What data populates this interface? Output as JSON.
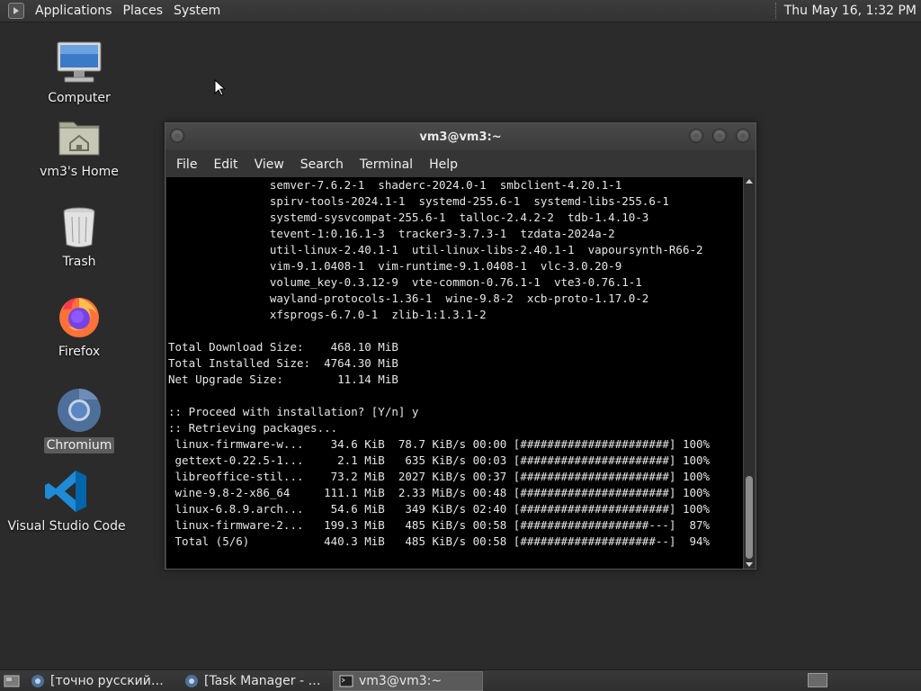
{
  "top_panel": {
    "menu": [
      "Applications",
      "Places",
      "System"
    ],
    "clock": "Thu May 16,  1:32 PM"
  },
  "desktop_icons": [
    {
      "label": "Computer",
      "icon": "computer-icon"
    },
    {
      "label": "vm3's Home",
      "icon": "home-folder-icon"
    },
    {
      "label": "Trash",
      "icon": "trash-icon"
    },
    {
      "label": "Firefox",
      "icon": "firefox-icon"
    },
    {
      "label": "Chromium",
      "icon": "chromium-icon",
      "selected": true
    },
    {
      "label": "Visual Studio Code",
      "icon": "vscode-icon"
    }
  ],
  "terminal": {
    "title": "vm3@vm3:~",
    "menu": [
      "File",
      "Edit",
      "View",
      "Search",
      "Terminal",
      "Help"
    ],
    "lines": [
      "               semver-7.6.2-1  shaderc-2024.0-1  smbclient-4.20.1-1",
      "               spirv-tools-2024.1-1  systemd-255.6-1  systemd-libs-255.6-1",
      "               systemd-sysvcompat-255.6-1  talloc-2.4.2-2  tdb-1.4.10-3",
      "               tevent-1:0.16.1-3  tracker3-3.7.3-1  tzdata-2024a-2",
      "               util-linux-2.40.1-1  util-linux-libs-2.40.1-1  vapoursynth-R66-2",
      "               vim-9.1.0408-1  vim-runtime-9.1.0408-1  vlc-3.0.20-9",
      "               volume_key-0.3.12-9  vte-common-0.76.1-1  vte3-0.76.1-1",
      "               wayland-protocols-1.36-1  wine-9.8-2  xcb-proto-1.17.0-2",
      "               xfsprogs-6.7.0-1  zlib-1:1.3.1-2",
      "",
      "Total Download Size:    468.10 MiB",
      "Total Installed Size:  4764.30 MiB",
      "Net Upgrade Size:        11.14 MiB",
      "",
      ":: Proceed with installation? [Y/n] y",
      ":: Retrieving packages...",
      " linux-firmware-w...    34.6 KiB  78.7 KiB/s 00:00 [######################] 100%",
      " gettext-0.22.5-1...     2.1 MiB   635 KiB/s 00:03 [######################] 100%",
      " libreoffice-stil...    73.2 MiB  2027 KiB/s 00:37 [######################] 100%",
      " wine-9.8-2-x86_64     111.1 MiB  2.33 MiB/s 00:48 [######################] 100%",
      " linux-6.8.9.arch...    54.6 MiB   349 KiB/s 02:40 [######################] 100%",
      " linux-firmware-2...   199.3 MiB   485 KiB/s 00:58 [###################---]  87%",
      " Total (5/6)           440.3 MiB   485 KiB/s 00:58 [####################--]  94%"
    ]
  },
  "taskbar": {
    "tasks": [
      {
        "label": "[точно русский? - Y...",
        "icon": "chromium-icon",
        "active": false
      },
      {
        "label": "[Task Manager - Ch...",
        "icon": "chromium-icon",
        "active": false
      },
      {
        "label": "vm3@vm3:~",
        "icon": "terminal-icon",
        "active": true
      }
    ]
  },
  "colors": {
    "desktop_bg": "#2b2b2b",
    "panel_bg": "#363636",
    "terminal_bg": "#000000",
    "terminal_fg": "#e6e6e6"
  }
}
